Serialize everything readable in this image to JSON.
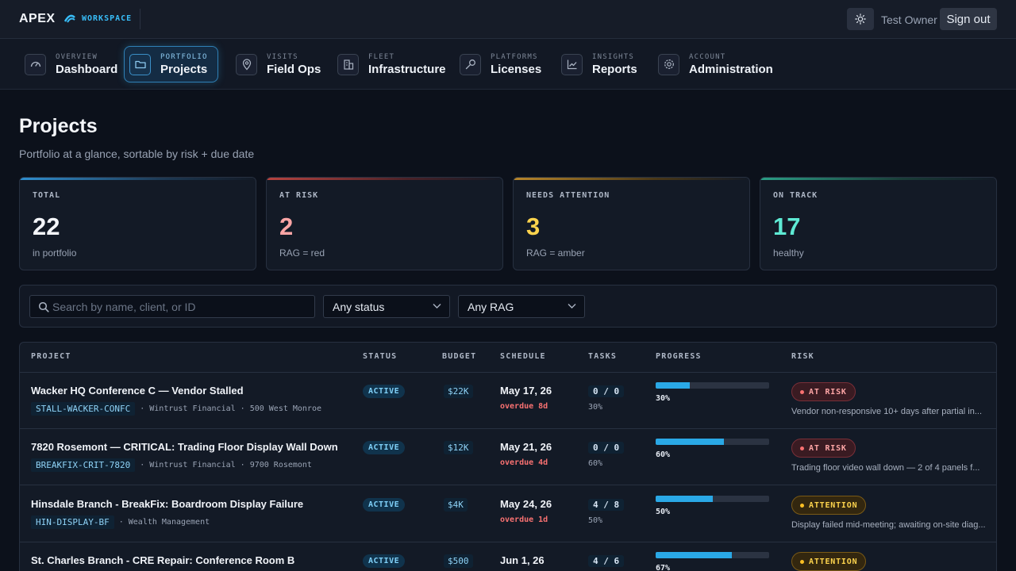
{
  "topbar": {
    "brand": "APEX",
    "workspace": "WORKSPACE",
    "user_name": "Test Owner",
    "sign_out": "Sign out"
  },
  "nav": [
    {
      "small": "OVERVIEW",
      "label": "Dashboard",
      "icon": "gauge-icon",
      "active": false
    },
    {
      "small": "PORTFOLIO",
      "label": "Projects",
      "icon": "folder-icon",
      "active": true
    },
    {
      "small": "VISITS",
      "label": "Field Ops",
      "icon": "map-pin-icon",
      "active": false
    },
    {
      "small": "FLEET",
      "label": "Infrastructure",
      "icon": "building-icon",
      "active": false
    },
    {
      "small": "PLATFORMS",
      "label": "Licenses",
      "icon": "key-icon",
      "active": false
    },
    {
      "small": "INSIGHTS",
      "label": "Reports",
      "icon": "chart-line-icon",
      "active": false
    },
    {
      "small": "ACCOUNT",
      "label": "Administration",
      "icon": "gear-icon",
      "active": false
    }
  ],
  "page": {
    "title": "Projects",
    "subtitle": "Portfolio at a glance, sortable by risk + due date"
  },
  "stats": [
    {
      "label": "TOTAL",
      "value": "22",
      "caption": "in portfolio",
      "color": "#f4f6fa",
      "accent": "#2f8fd0"
    },
    {
      "label": "AT RISK",
      "value": "2",
      "caption": "RAG = red",
      "color": "#fca5a5",
      "accent": "#b8433f"
    },
    {
      "label": "NEEDS ATTENTION",
      "value": "3",
      "caption": "RAG = amber",
      "color": "#fcd34d",
      "accent": "#b8862a"
    },
    {
      "label": "ON TRACK",
      "value": "17",
      "caption": "healthy",
      "color": "#5eead4",
      "accent": "#2a9f86"
    }
  ],
  "filters": {
    "search_placeholder": "Search by name, client, or ID",
    "status_value": "Any status",
    "rag_value": "Any RAG"
  },
  "table": {
    "headers": {
      "project": "PROJECT",
      "status": "STATUS",
      "budget": "BUDGET",
      "schedule": "SCHEDULE",
      "tasks": "TASKS",
      "progress": "PROGRESS",
      "risk": "RISK"
    },
    "rows": [
      {
        "name": "Wacker HQ Conference C — Vendor Stalled",
        "code": "STALL-WACKER-CONFC",
        "info": "· Wintrust Financial · 500 West Monroe",
        "status": "ACTIVE",
        "budget": "$22K",
        "schedule": "May 17, 26",
        "overdue": "overdue 8d",
        "tasks": "0 / 0",
        "tasks_pct": "30%",
        "progress": 30,
        "progress_label": "30%",
        "risk": "AT RISK",
        "risk_level": "red",
        "risk_note": "Vendor non-responsive 10+ days after partial in..."
      },
      {
        "name": "7820 Rosemont — CRITICAL: Trading Floor Display Wall Down",
        "code": "BREAKFIX-CRIT-7820",
        "info": "· Wintrust Financial · 9700 Rosemont",
        "status": "ACTIVE",
        "budget": "$12K",
        "schedule": "May 21, 26",
        "overdue": "overdue 4d",
        "tasks": "0 / 0",
        "tasks_pct": "60%",
        "progress": 60,
        "progress_label": "60%",
        "risk": "AT RISK",
        "risk_level": "red",
        "risk_note": "Trading floor video wall down — 2 of 4 panels f..."
      },
      {
        "name": "Hinsdale Branch - BreakFix: Boardroom Display Failure",
        "code": "HIN-DISPLAY-BF",
        "info": "· Wealth Management",
        "status": "ACTIVE",
        "budget": "$4K",
        "schedule": "May 24, 26",
        "overdue": "overdue 1d",
        "tasks": "4 / 8",
        "tasks_pct": "50%",
        "progress": 50,
        "progress_label": "50%",
        "risk": "ATTENTION",
        "risk_level": "amber",
        "risk_note": "Display failed mid-meeting; awaiting on-site diag..."
      },
      {
        "name": "St. Charles Branch - CRE Repair: Conference Room B",
        "code": "",
        "info": "",
        "status": "ACTIVE",
        "budget": "$500",
        "schedule": "Jun 1, 26",
        "overdue": "",
        "tasks": "4 / 6",
        "tasks_pct": "",
        "progress": 67,
        "progress_label": "67%",
        "risk": "ATTENTION",
        "risk_level": "amber",
        "risk_note": ""
      }
    ]
  }
}
